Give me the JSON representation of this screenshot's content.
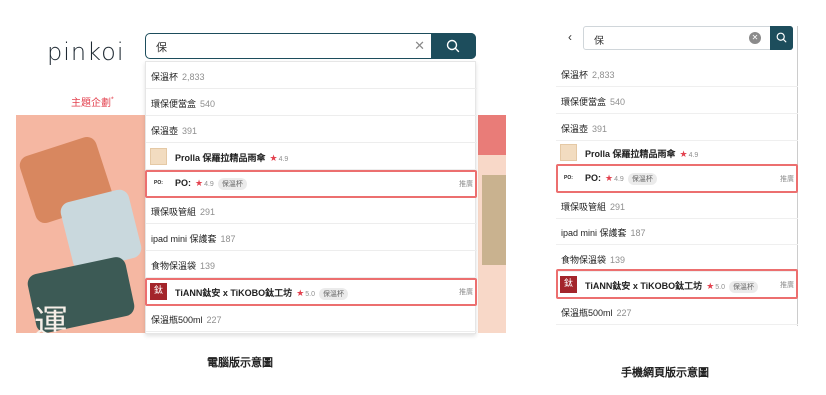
{
  "desktop": {
    "logo": "pinkoi",
    "promo_label": "主題企劃",
    "promo_mark": "*",
    "banner_glyph": "運",
    "search": {
      "query": "保",
      "clear_glyph": "✕"
    },
    "suggestions": [
      {
        "kind": "keyword",
        "text": "保溫杯",
        "count": "2,833"
      },
      {
        "kind": "keyword",
        "text": "環保便當盒",
        "count": "540"
      },
      {
        "kind": "keyword",
        "text": "保溫壺",
        "count": "391"
      },
      {
        "kind": "product",
        "thumb": "prolla",
        "name": "Prolla 保羅拉精品雨傘",
        "star": "★",
        "rating": "4.9",
        "tag": "",
        "ad": ""
      },
      {
        "kind": "product",
        "thumb": "po",
        "thumb_text": "PO:",
        "name": "PO:",
        "star": "★",
        "rating": "4.9",
        "tag": "保溫杯",
        "ad": "推廣"
      },
      {
        "kind": "keyword",
        "text": "環保吸管組",
        "count": "291"
      },
      {
        "kind": "keyword",
        "text": "ipad mini 保護套",
        "count": "187"
      },
      {
        "kind": "keyword",
        "text": "食物保溫袋",
        "count": "139"
      },
      {
        "kind": "product",
        "thumb": "tiann",
        "thumb_text": "鈦",
        "name": "TiANN鈦安 x TiKOBO鈦工坊",
        "star": "★",
        "rating": "5.0",
        "tag": "保溫杯",
        "ad": "推廣"
      },
      {
        "kind": "keyword",
        "text": "保溫瓶500ml",
        "count": "227"
      }
    ],
    "caption": "電腦版示意圖"
  },
  "mobile": {
    "back_glyph": "‹",
    "search": {
      "query": "保",
      "clear_glyph": "✕"
    },
    "suggestions": [
      {
        "kind": "keyword",
        "text": "保溫杯",
        "count": "2,833"
      },
      {
        "kind": "keyword",
        "text": "環保便當盒",
        "count": "540"
      },
      {
        "kind": "keyword",
        "text": "保溫壺",
        "count": "391"
      },
      {
        "kind": "product",
        "thumb": "prolla",
        "name": "Prolla 保羅拉精品雨傘",
        "star": "★",
        "rating": "4.9",
        "tag": "",
        "ad": ""
      },
      {
        "kind": "product",
        "thumb": "po",
        "thumb_text": "PO:",
        "name": "PO:",
        "star": "★",
        "rating": "4.9",
        "tag": "保溫杯",
        "ad": "推廣"
      },
      {
        "kind": "keyword",
        "text": "環保吸管組",
        "count": "291"
      },
      {
        "kind": "keyword",
        "text": "ipad mini 保護套",
        "count": "187"
      },
      {
        "kind": "keyword",
        "text": "食物保溫袋",
        "count": "139"
      },
      {
        "kind": "product",
        "thumb": "tiann",
        "thumb_text": "鈦",
        "name": "TiANN鈦安 x TiKOBO鈦工坊",
        "star": "★",
        "rating": "5.0",
        "tag": "保溫杯",
        "ad": "推廣"
      },
      {
        "kind": "keyword",
        "text": "保溫瓶500ml",
        "count": "227"
      }
    ],
    "caption": "手機網頁版示意圖"
  },
  "colors": {
    "brand_teal": "#1d4d5c",
    "highlight_red": "#ec6f6f",
    "star_red": "#e3424f"
  },
  "icons": {
    "search_button": "search-icon",
    "clear_button": "clear-icon",
    "back_button": "chevron-left-icon"
  }
}
